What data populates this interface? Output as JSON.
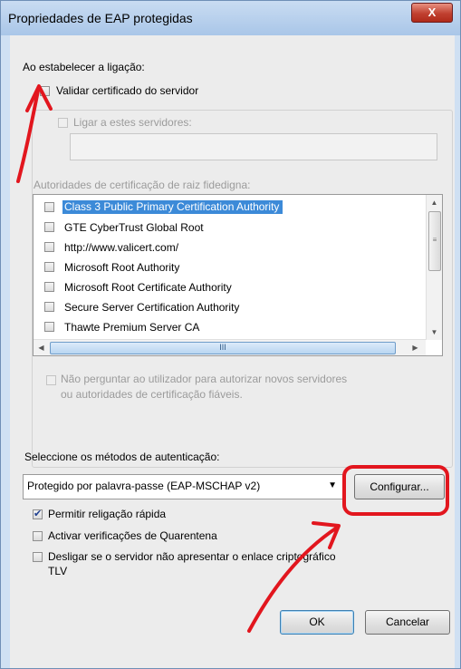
{
  "window": {
    "title": "Propriedades de EAP protegidas",
    "close_glyph": "X"
  },
  "connect": {
    "heading": "Ao estabelecer a ligação:",
    "validate_cert_label": "Validar certificado do servidor",
    "validate_cert_checked": false,
    "connect_servers_label": "Ligar a estes servidores:",
    "connect_servers_value": "",
    "root_ca_label": "Autoridades de certificação de raiz fidedigna:",
    "ca_list": [
      {
        "label": "Class 3 Public Primary Certification Authority",
        "checked": false,
        "selected": true
      },
      {
        "label": "GTE CyberTrust Global Root",
        "checked": false,
        "selected": false
      },
      {
        "label": "http://www.valicert.com/",
        "checked": false,
        "selected": false
      },
      {
        "label": "Microsoft Root Authority",
        "checked": false,
        "selected": false
      },
      {
        "label": "Microsoft Root Certificate Authority",
        "checked": false,
        "selected": false
      },
      {
        "label": "Secure Server Certification Authority",
        "checked": false,
        "selected": false
      },
      {
        "label": "Thawte Premium Server CA",
        "checked": false,
        "selected": false
      }
    ],
    "no_prompt_line1": "Não perguntar ao utilizador para autorizar novos servidores",
    "no_prompt_line2": "ou autoridades de certificação fiáveis."
  },
  "auth": {
    "heading": "Seleccione os métodos de autenticação:",
    "method_value": "Protegido por palavra-passe (EAP-MSCHAP v2)",
    "configure_label": "Configurar...",
    "fast_reconnect_label": "Permitir religação rápida",
    "fast_reconnect_checked": true,
    "quarantine_label": "Activar verificações de Quarentena",
    "quarantine_checked": false,
    "disconnect_line1": "Desligar se o servidor não apresentar o enlace criptográfico",
    "disconnect_line2": "TLV",
    "disconnect_checked": false
  },
  "buttons": {
    "ok": "OK",
    "cancel": "Cancelar"
  },
  "icons": {
    "close": "close-icon",
    "scroll_up": "chevron-up-icon",
    "scroll_down": "chevron-down-icon",
    "scroll_left": "chevron-left-icon",
    "scroll_right": "chevron-right-icon",
    "dropdown": "chevron-down-icon"
  },
  "colors": {
    "annotation_red": "#e2161e",
    "selection_blue": "#3c8ad8",
    "title_bar": "#b8d1ee"
  }
}
